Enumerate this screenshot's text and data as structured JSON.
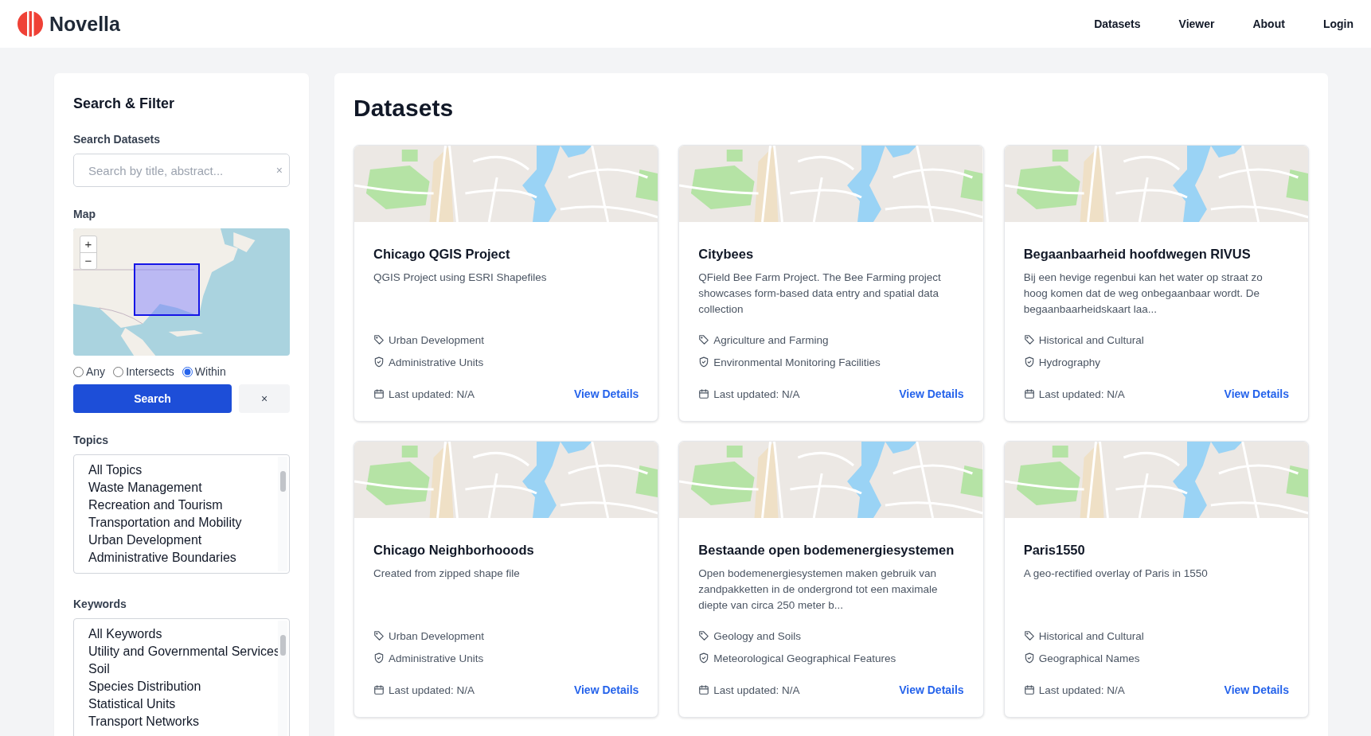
{
  "header": {
    "brand": "Novella",
    "nav": [
      "Datasets",
      "Viewer",
      "About",
      "Login"
    ]
  },
  "filter": {
    "title": "Search & Filter",
    "search_label": "Search Datasets",
    "search": {
      "placeholder": "Search by title, abstract...",
      "clear": "×"
    },
    "map_label": "Map",
    "map_zoom": [
      "+",
      "−"
    ],
    "spatial_modes": [
      {
        "label": "Any",
        "selected": false
      },
      {
        "label": "Intersects",
        "selected": false
      },
      {
        "label": "Within",
        "selected": true
      }
    ],
    "search_button": "Search",
    "clear_button": "×",
    "topics_label": "Topics",
    "topics": [
      "All Topics",
      "Waste Management",
      "Recreation and Tourism",
      "Transportation and Mobility",
      "Urban Development",
      "Administrative Boundaries"
    ],
    "keywords_label": "Keywords",
    "keywords": [
      "All Keywords",
      "Utility and Governmental Services",
      "Soil",
      "Species Distribution",
      "Statistical Units",
      "Transport Networks"
    ]
  },
  "main": {
    "title": "Datasets",
    "datasets": [
      {
        "title": "Chicago QGIS Project",
        "description": "QGIS Project using ESRI Shapefiles",
        "topic": "Urban Development",
        "category": "Administrative Units",
        "updated": "Last updated: N/A",
        "link": "View Details"
      },
      {
        "title": "Citybees",
        "description": "QField Bee Farm Project. The Bee Farming project showcases form-based data entry and spatial data collection",
        "topic": "Agriculture and Farming",
        "category": "Environmental Monitoring Facilities",
        "updated": "Last updated: N/A",
        "link": "View Details"
      },
      {
        "title": "Begaanbaarheid hoofdwegen RIVUS",
        "description": "Bij een hevige regenbui kan het water op straat zo hoog komen dat de weg onbegaanbaar wordt. De begaanbaarheidskaart laa...",
        "topic": "Historical and Cultural",
        "category": "Hydrography",
        "updated": "Last updated: N/A",
        "link": "View Details"
      },
      {
        "title": "Chicago Neighborhooods",
        "description": "Created from zipped shape file",
        "topic": "Urban Development",
        "category": "Administrative Units",
        "updated": "Last updated: N/A",
        "link": "View Details"
      },
      {
        "title": "Bestaande open bodemenergiesystemen",
        "description": "Open bodemenergiesystemen maken gebruik van zandpakketten in de ondergrond tot een maximale diepte van circa 250 meter b...",
        "topic": "Geology and Soils",
        "category": "Meteorological Geographical Features",
        "updated": "Last updated: N/A",
        "link": "View Details"
      },
      {
        "title": "Paris1550",
        "description": "A geo-rectified overlay of Paris in 1550",
        "topic": "Historical and Cultural",
        "category": "Geographical Names",
        "updated": "Last updated: N/A",
        "link": "View Details"
      }
    ]
  }
}
